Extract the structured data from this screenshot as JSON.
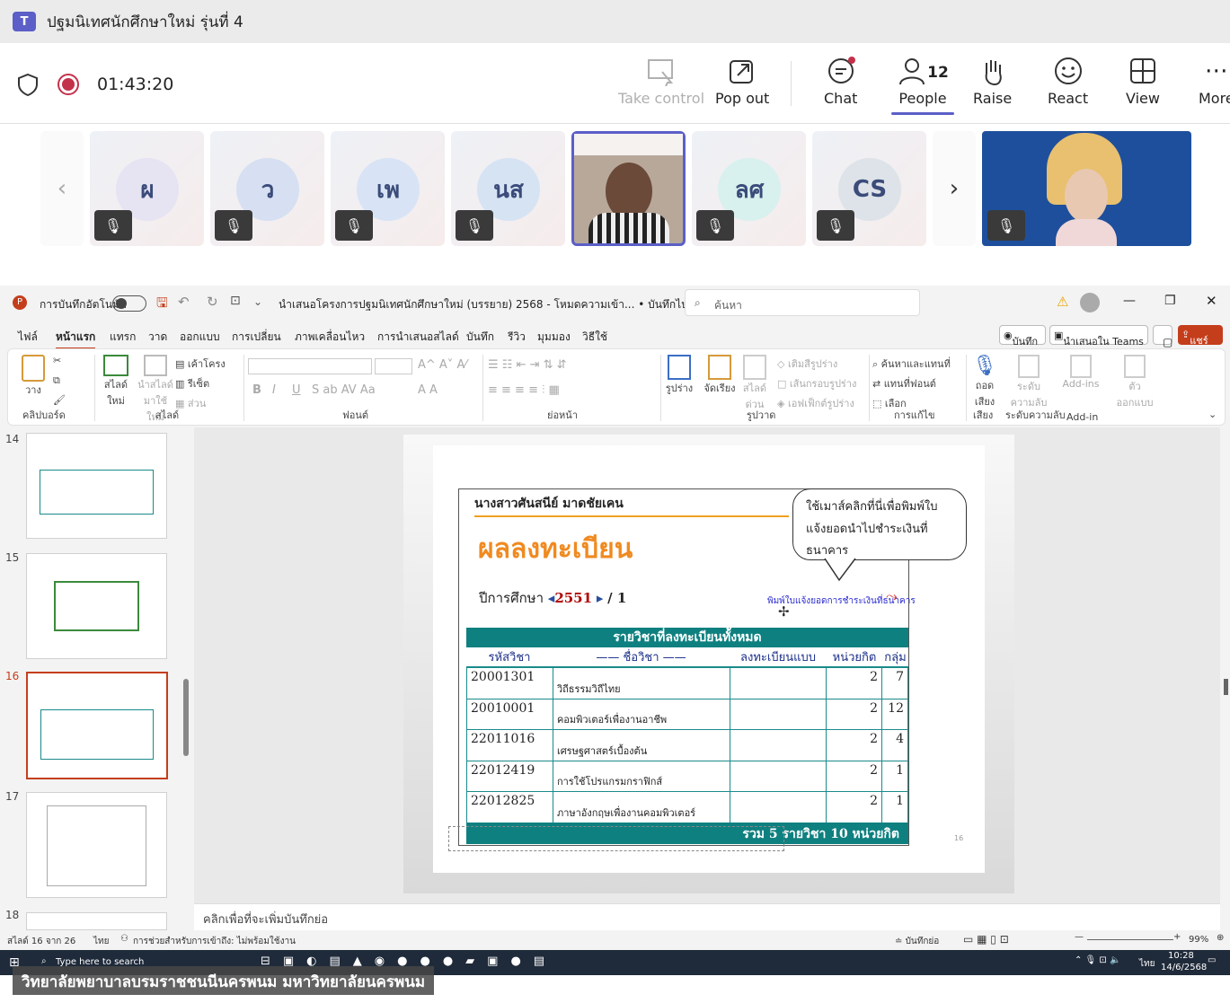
{
  "window": {
    "title": "ปฐมนิเทศนักศึกษาใหม่ รุ่นที่ 4",
    "logo": "T"
  },
  "meeting": {
    "timer": "01:43:20",
    "people_count": "12",
    "buttons": [
      {
        "label": "Take control",
        "icon": "take-control-icon"
      },
      {
        "label": "Pop out",
        "icon": "pop-out-icon"
      },
      {
        "label": "Chat",
        "icon": "chat-icon"
      },
      {
        "label": "People",
        "icon": "people-icon"
      },
      {
        "label": "Raise",
        "icon": "raise-hand-icon"
      },
      {
        "label": "React",
        "icon": "react-icon"
      },
      {
        "label": "View",
        "icon": "view-icon"
      },
      {
        "label": "More",
        "icon": "more-icon"
      }
    ]
  },
  "participants": [
    "ผ",
    "ว",
    "เพ",
    "นส",
    "ลศ",
    "CS"
  ],
  "ppt": {
    "autosave": "การบันทึกอัตโนมัติ",
    "doc_title": "นำเสนอโครงการปฐมนิเทศนักศึกษาใหม่ (บรรยาย) 2568 - โหมดความเข้า... • บันทึกไปยัง พีซีนี้",
    "search_placeholder": "ค้นหา",
    "tabs": [
      "ไฟล์",
      "หน้าแรก",
      "แทรก",
      "วาด",
      "ออกแบบ",
      "การเปลี่ยน",
      "ภาพเคลื่อนไหว",
      "การนำเสนอสไลด์",
      "บันทึก",
      "รีวิว",
      "มุมมอง",
      "วิธีใช้"
    ],
    "record_btn": "บันทึก",
    "present_teams": "นำเสนอใน Teams",
    "share": "แชร์",
    "ribbon": {
      "paste": "วาง",
      "clipboard": "คลิปบอร์ด",
      "new_slide": "สไลด์ใหม่",
      "reuse": "นำสไลด์มาใช้ใหม่",
      "layout": "เค้าโครง",
      "reset": "รีเซ็ต",
      "section": "ส่วน",
      "slides": "สไลด์",
      "font": "ฟอนต์",
      "paragraph": "ย่อหน้า",
      "shapes": "รูปร่าง",
      "arrange": "จัดเรียง",
      "quick_styles": "สไลด์ด่วน",
      "fill": "เติมสีรูปร่าง",
      "outline": "เส้นกรอบรูปร่าง",
      "effects": "เอฟเฟ็กต์รูปร่าง",
      "drawing": "รูปวาด",
      "find": "ค้นหาและแทนที่",
      "replace": "แทนที่ฟอนต์",
      "select": "เลือก",
      "editing": "การแก้ไข",
      "dictate": "ถอดเสียง",
      "voice": "เสียง",
      "sensitivity": "ระดับความลับ",
      "sensitivity_grp": "ระดับความลับ",
      "addins": "Add-ins",
      "addins_grp": "Add-in",
      "designer": "ตัวออกแบบ"
    },
    "thumbs": [
      "14",
      "15",
      "16",
      "17",
      "18"
    ],
    "notes": "คลิกเพื่อที่จะเพิ่มบันทึกย่อ",
    "status": {
      "slide": "สไลด์ 16 จาก 26",
      "lang": "ไทย",
      "access": "การช่วยสำหรับการเข้าถึง: ไม่พร้อมใช้งาน",
      "notes_btn": "บันทึกย่อ",
      "zoom": "99%"
    }
  },
  "slide": {
    "name": "นางสาวศันสนีย์ มาดชัยเคน",
    "heading": "ผลลงทะเบียน",
    "year_label": "ปีการศึกษา",
    "year": "2551",
    "term": "/ 1",
    "callout": "ใช้เมาส์คลิกที่นี่เพื่อพิมพ์ใบแจ้งยอดนำไปชำระเงินที่ธนาคาร",
    "print_link": "พิมพ์ใบแจ้งยอดการชำระเงินที่ธนาคาร",
    "table_title": "รายวิชาที่ลงทะเบียนทั้งหมด",
    "headers": [
      "รหัสวิชา",
      "—— ชื่อวิชา ——",
      "ลงทะเบียนแบบ",
      "หน่วยกิต",
      "กลุ่ม"
    ],
    "rows": [
      [
        "20001301",
        "วิถีธรรมวิถีไทย",
        "",
        "2",
        "7"
      ],
      [
        "20010001",
        "คอมพิวเตอร์เพื่องานอาชีพ",
        "",
        "2",
        "12"
      ],
      [
        "22011016",
        "เศรษฐศาสตร์เบื้องต้น",
        "",
        "2",
        "4"
      ],
      [
        "22012419",
        "การใช้โปรแกรมกราฟิกส์",
        "",
        "2",
        "1"
      ],
      [
        "22012825",
        "ภาษาอังกฤษเพื่องานคอมพิวเตอร์",
        "",
        "2",
        "1"
      ]
    ],
    "total": "รวม 5 รายวิชา 10 หน่วยกิต",
    "page_no": "16"
  },
  "taskbar": {
    "search": "Type here to search",
    "time": "10:28",
    "date": "14/6/2568",
    "lang": "ไทย"
  },
  "caption": "วิทยาลัยพยาบาลบรมราชชนนีนครพนม มหาวิทยาลัยนครพนม"
}
